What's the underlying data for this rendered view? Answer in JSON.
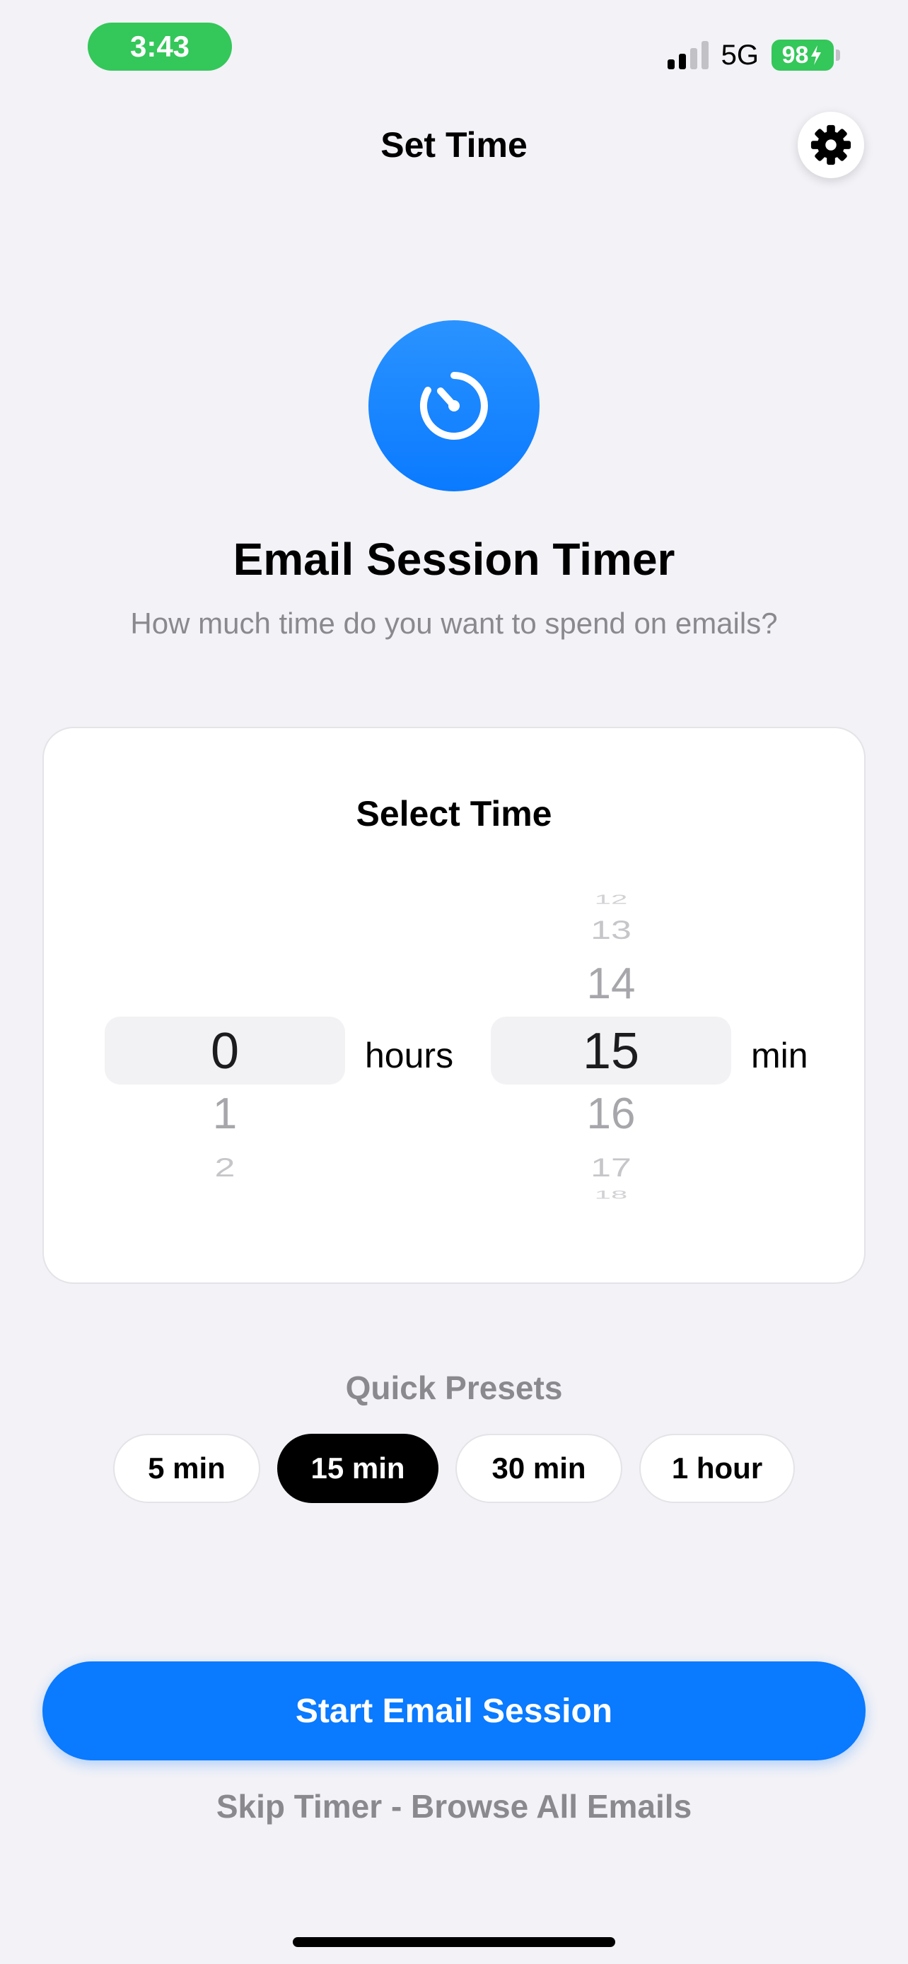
{
  "status_bar": {
    "time": "3:43",
    "network": "5G",
    "battery": "98",
    "colors": {
      "time_pill": "#34c759",
      "battery": "#34c759"
    }
  },
  "nav": {
    "title": "Set Time",
    "settings_icon": "gear-icon"
  },
  "hero": {
    "icon": "timer-icon",
    "title": "Email Session Timer",
    "subtitle": "How much time do you want to spend on emails?",
    "accent_color": "#0a7aff"
  },
  "picker": {
    "title": "Select Time",
    "hours": {
      "unit": "hours",
      "selected": "0",
      "below": [
        "1",
        "2"
      ]
    },
    "minutes": {
      "unit": "min",
      "above": [
        "12",
        "13",
        "14"
      ],
      "selected": "15",
      "below": [
        "16",
        "17",
        "18"
      ]
    }
  },
  "presets": {
    "label": "Quick Presets",
    "items": [
      {
        "label": "5 min",
        "active": false
      },
      {
        "label": "15 min",
        "active": true
      },
      {
        "label": "30 min",
        "active": false
      },
      {
        "label": "1 hour",
        "active": false
      }
    ]
  },
  "actions": {
    "start_label": "Start Email Session",
    "skip_label": "Skip Timer - Browse All Emails"
  }
}
